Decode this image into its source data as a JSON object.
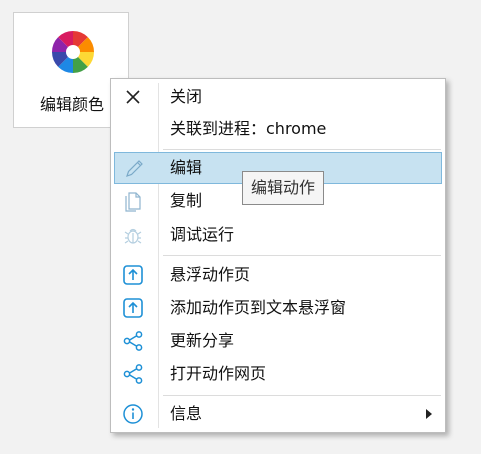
{
  "tile": {
    "label": "编辑颜色",
    "icon": "color-wheel-icon"
  },
  "menu": {
    "items": [
      {
        "label": "关闭",
        "icon": "close-icon"
      },
      {
        "label": "关联到进程：chrome",
        "icon": ""
      },
      {
        "label": "编辑",
        "icon": "pencil-icon",
        "state": "hovered"
      },
      {
        "label": "复制",
        "icon": "copy-icon"
      },
      {
        "label": "调试运行",
        "icon": "bug-icon"
      },
      {
        "label": "悬浮动作页",
        "icon": "upload-icon"
      },
      {
        "label": "添加动作页到文本悬浮窗",
        "icon": "upload-icon"
      },
      {
        "label": "更新分享",
        "icon": "share-icon"
      },
      {
        "label": "打开动作网页",
        "icon": "share-icon"
      },
      {
        "label": "信息",
        "icon": "info-icon",
        "submenu": true
      }
    ]
  },
  "tooltip": {
    "text": "编辑动作"
  },
  "colors": {
    "accent": "#1e90d6",
    "hover_bg": "#c7e2f1",
    "hover_border": "#7fb8dc",
    "disabled_icon": "#b5cfe0",
    "wheel": [
      "#e53935",
      "#fb8c00",
      "#fdd835",
      "#43a047",
      "#1e88e5",
      "#3949ab",
      "#8e24aa",
      "#d81b60"
    ]
  }
}
